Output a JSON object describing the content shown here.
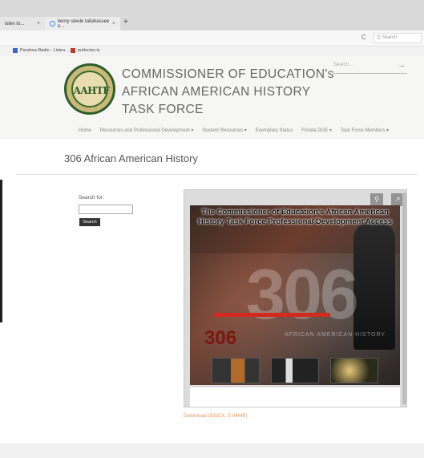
{
  "browser": {
    "tabs": [
      {
        "label": "isten to...",
        "close": "×"
      },
      {
        "label": "henry steele tallahassee o...",
        "close": "×"
      }
    ],
    "new_tab": "+",
    "reload": "C",
    "search_placeholder": "Q Search",
    "bookmarks": [
      {
        "label": "Pandora Radio - Listen..."
      },
      {
        "label": "putlocker.is"
      }
    ]
  },
  "site": {
    "logo_text": "AAHTF",
    "title_lines": [
      "COMMISSIONER OF EDUCATION's",
      "AFRICAN AMERICAN HISTORY",
      "TASK FORCE"
    ],
    "search_placeholder": "Search...",
    "search_arrow": "→",
    "nav": [
      "Home",
      "Resources and Professional Development ▾",
      "Student Resources ▾",
      "Exemplary Status",
      "Florida DOE ▾",
      "Task Force Members ▾"
    ]
  },
  "page": {
    "title": "306 African American History",
    "search_label": "Search for:",
    "search_value": "",
    "search_button": "Search"
  },
  "viewer": {
    "controls": [
      "⚲",
      "↗"
    ],
    "slide_title": "The Commissioner of Education's African American History Task Force Professional Development Access",
    "big_number": "306",
    "small_number": "306",
    "subtitle": "AFRICAN AMERICAN HISTORY"
  },
  "download_link": "Download (DOCX, 5.04MB)",
  "colors": {
    "accent_link": "#e59a5b",
    "logo_green": "#2e5d2a",
    "slide_red": "#d22a1e"
  }
}
